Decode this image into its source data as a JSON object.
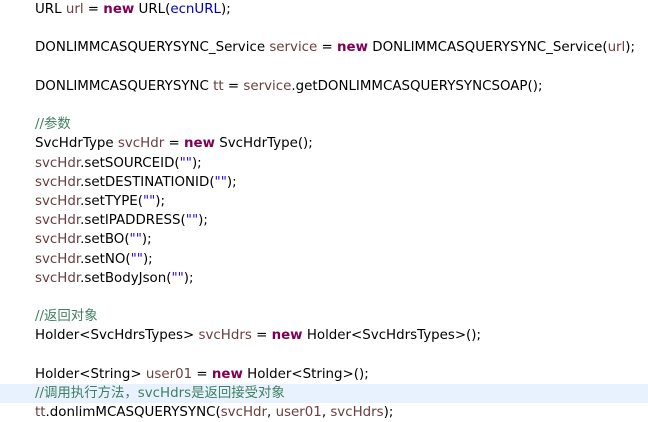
{
  "editor": {
    "lines": [
      {
        "tokens": [
          [
            "p",
            "URL "
          ],
          [
            "var",
            "url"
          ],
          [
            "p",
            " = "
          ],
          [
            "kw",
            "new"
          ],
          [
            "p",
            " URL("
          ],
          [
            "field",
            "ecnURL"
          ],
          [
            "p",
            ");"
          ]
        ]
      },
      {
        "tokens": []
      },
      {
        "tokens": [
          [
            "p",
            "DONLIMMCASQUERYSYNC_Service "
          ],
          [
            "var",
            "service"
          ],
          [
            "p",
            " = "
          ],
          [
            "kw",
            "new"
          ],
          [
            "p",
            " DONLIMMCASQUERYSYNC_Service("
          ],
          [
            "var",
            "url"
          ],
          [
            "p",
            ");"
          ]
        ]
      },
      {
        "tokens": []
      },
      {
        "tokens": [
          [
            "p",
            "DONLIMMCASQUERYSYNC "
          ],
          [
            "var",
            "tt"
          ],
          [
            "p",
            " = "
          ],
          [
            "var",
            "service"
          ],
          [
            "p",
            ".getDONLIMMCASQUERYSYNCSOAP();"
          ]
        ]
      },
      {
        "tokens": []
      },
      {
        "tokens": [
          [
            "cm",
            "//参数"
          ]
        ]
      },
      {
        "tokens": [
          [
            "p",
            "SvcHdrType "
          ],
          [
            "var",
            "svcHdr"
          ],
          [
            "p",
            " = "
          ],
          [
            "kw",
            "new"
          ],
          [
            "p",
            " SvcHdrType();"
          ]
        ]
      },
      {
        "tokens": [
          [
            "var",
            "svcHdr"
          ],
          [
            "p",
            ".setSOURCEID("
          ],
          [
            "str",
            "\"\""
          ],
          [
            "p",
            ");"
          ]
        ]
      },
      {
        "tokens": [
          [
            "var",
            "svcHdr"
          ],
          [
            "p",
            ".setDESTINATIONID("
          ],
          [
            "str",
            "\"\""
          ],
          [
            "p",
            ");"
          ]
        ]
      },
      {
        "tokens": [
          [
            "var",
            "svcHdr"
          ],
          [
            "p",
            ".setTYPE("
          ],
          [
            "str",
            "\"\""
          ],
          [
            "p",
            ");"
          ]
        ]
      },
      {
        "tokens": [
          [
            "var",
            "svcHdr"
          ],
          [
            "p",
            ".setIPADDRESS("
          ],
          [
            "str",
            "\"\""
          ],
          [
            "p",
            ");"
          ]
        ]
      },
      {
        "tokens": [
          [
            "var",
            "svcHdr"
          ],
          [
            "p",
            ".setBO("
          ],
          [
            "str",
            "\"\""
          ],
          [
            "p",
            ");"
          ]
        ]
      },
      {
        "tokens": [
          [
            "var",
            "svcHdr"
          ],
          [
            "p",
            ".setNO("
          ],
          [
            "str",
            "\"\""
          ],
          [
            "p",
            ");"
          ]
        ]
      },
      {
        "tokens": [
          [
            "var",
            "svcHdr"
          ],
          [
            "p",
            ".setBodyJson("
          ],
          [
            "str",
            "\"\""
          ],
          [
            "p",
            ");"
          ]
        ]
      },
      {
        "tokens": []
      },
      {
        "tokens": [
          [
            "cm",
            "//返回对象"
          ]
        ]
      },
      {
        "tokens": [
          [
            "p",
            "Holder<SvcHdrsTypes> "
          ],
          [
            "var",
            "svcHdrs"
          ],
          [
            "p",
            " = "
          ],
          [
            "kw",
            "new"
          ],
          [
            "p",
            " Holder<SvcHdrsTypes>();"
          ]
        ]
      },
      {
        "tokens": []
      },
      {
        "tokens": [
          [
            "p",
            "Holder<String> "
          ],
          [
            "var",
            "user01"
          ],
          [
            "p",
            " = "
          ],
          [
            "kw",
            "new"
          ],
          [
            "p",
            " Holder<String>();"
          ]
        ]
      },
      {
        "tokens": [
          [
            "cm",
            "//调用执行方法，svcHdrs是返回接受对象"
          ]
        ],
        "highlighted": true
      },
      {
        "tokens": [
          [
            "var",
            "tt"
          ],
          [
            "p",
            ".donlimMCASQUERYSYNC("
          ],
          [
            "var",
            "svcHdr"
          ],
          [
            "p",
            ", "
          ],
          [
            "var",
            "user01"
          ],
          [
            "p",
            ", "
          ],
          [
            "var",
            "svcHdrs"
          ],
          [
            "p",
            ");"
          ]
        ]
      }
    ]
  },
  "colors": {
    "keyword": "#7f0055",
    "local_variable": "#6a3e3e",
    "field": "#0000c0",
    "string": "#2a00ff",
    "comment": "#3f7f5f",
    "current_line_highlight": "#e8f2fe"
  }
}
